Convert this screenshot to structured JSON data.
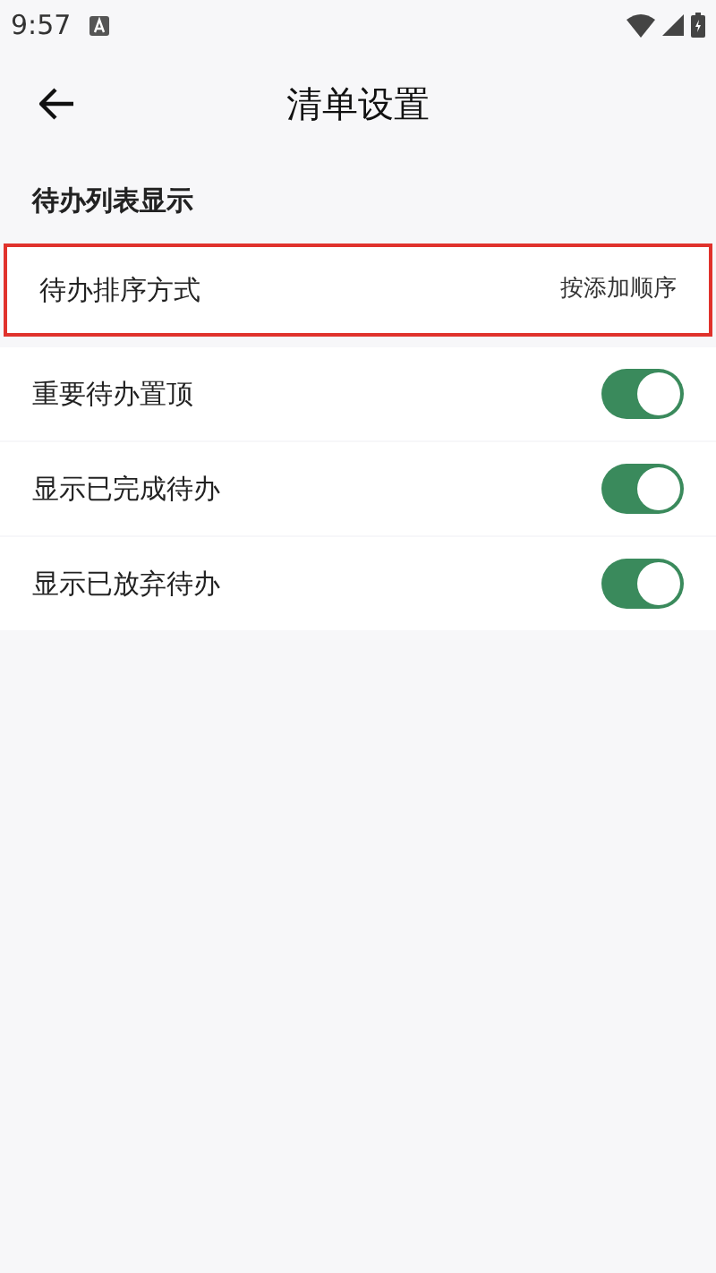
{
  "status_bar": {
    "time": "9:57"
  },
  "header": {
    "title": "清单设置"
  },
  "section": {
    "title": "待办列表显示"
  },
  "rows": [
    {
      "kind": "value",
      "label": "待办排序方式",
      "value": "按添加顺序",
      "highlighted": true
    },
    {
      "kind": "switch",
      "label": "重要待办置顶",
      "on": true,
      "highlighted": false
    },
    {
      "kind": "switch",
      "label": "显示已完成待办",
      "on": true,
      "highlighted": false
    },
    {
      "kind": "switch",
      "label": "显示已放弃待办",
      "on": true,
      "highlighted": false
    }
  ]
}
